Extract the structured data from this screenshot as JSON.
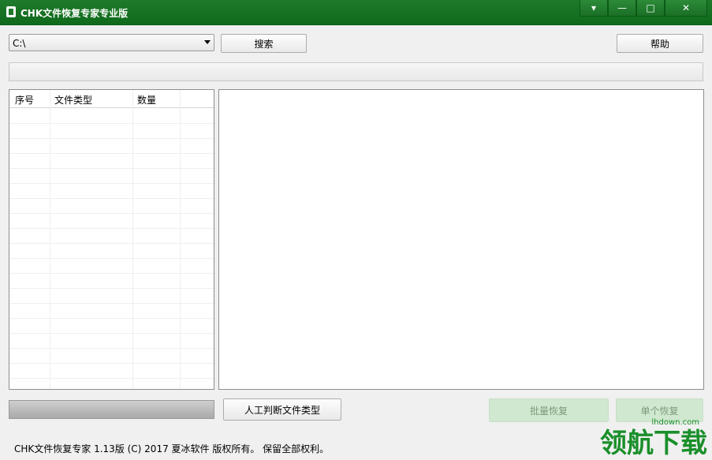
{
  "window": {
    "title": "CHK文件恢复专家专业版",
    "controls": {
      "menu": "▾",
      "minimize": "—",
      "maximize": "□",
      "close": "✕"
    }
  },
  "toolbar": {
    "drive_value": "C:\\",
    "search_label": "搜索",
    "help_label": "帮助"
  },
  "table": {
    "columns": [
      "序号",
      "文件类型",
      "数量"
    ],
    "rows": []
  },
  "bottom": {
    "judge_label": "人工判断文件类型",
    "batch_label": "批量恢复",
    "single_label": "单个恢复"
  },
  "status": {
    "text": "CHK文件恢复专家 1.13版 (C) 2017 夏冰软件 版权所有。 保留全部权利。"
  },
  "watermark": {
    "text": "领航下载",
    "url": "lhdown.com"
  },
  "colors": {
    "titlebar": "#1f7a2b",
    "disabled_button": "#cfe8cf",
    "watermark": "#1a8f2a"
  }
}
